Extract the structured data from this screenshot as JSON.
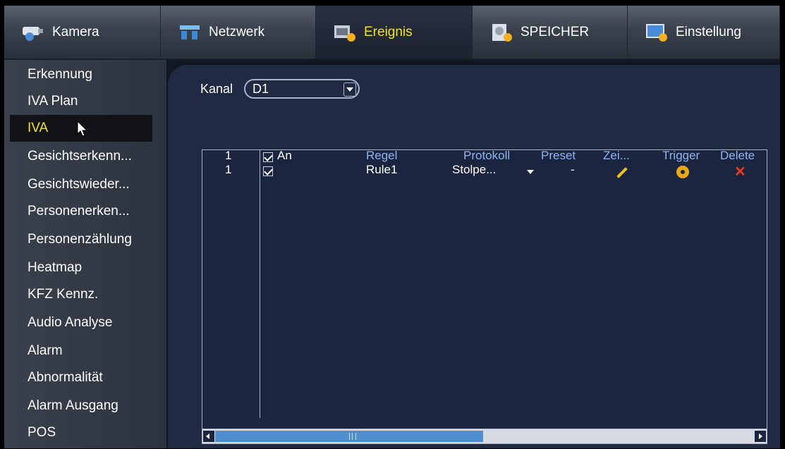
{
  "tabs": [
    {
      "label": "Kamera",
      "icon": "camera-icon",
      "active": false
    },
    {
      "label": "Netzwerk",
      "icon": "network-icon",
      "active": false
    },
    {
      "label": "Ereignis",
      "icon": "event-icon",
      "active": true
    },
    {
      "label": "SPEICHER",
      "icon": "storage-icon",
      "active": false
    },
    {
      "label": "Einstellung",
      "icon": "settings-monitor-icon",
      "active": false
    }
  ],
  "sidebar": {
    "items": [
      {
        "label": "Erkennung"
      },
      {
        "label": "IVA Plan"
      },
      {
        "label": "IVA",
        "active": true
      },
      {
        "label": "Gesichtserkenn..."
      },
      {
        "label": "Gesichtswieder..."
      },
      {
        "label": "Personenerken..."
      },
      {
        "label": "Personenzählung"
      },
      {
        "label": "Heatmap"
      },
      {
        "label": "KFZ Kennz."
      },
      {
        "label": "Audio Analyse"
      },
      {
        "label": "Alarm"
      },
      {
        "label": "Abnormalität"
      },
      {
        "label": "Alarm Ausgang"
      },
      {
        "label": "POS"
      }
    ]
  },
  "main": {
    "kanal_label": "Kanal",
    "kanal_value": "D1"
  },
  "table": {
    "headers": {
      "num": "1",
      "an": "An",
      "regel": "Regel",
      "protokoll": "Protokoll",
      "preset": "Preset",
      "zeichnen": "Zei...",
      "trigger": "Trigger",
      "delete": "Delete"
    },
    "rows": [
      {
        "num": "1",
        "checked": true,
        "regel": "Rule1",
        "protokoll": "Stolpe...",
        "preset": "-"
      }
    ]
  },
  "colors": {
    "active_text": "#f2e21a",
    "panel_bg": "#202a42",
    "scroll_thumb": "#4f8fd0",
    "delete": "#e83a1a",
    "pencil": "#f2c21a"
  }
}
